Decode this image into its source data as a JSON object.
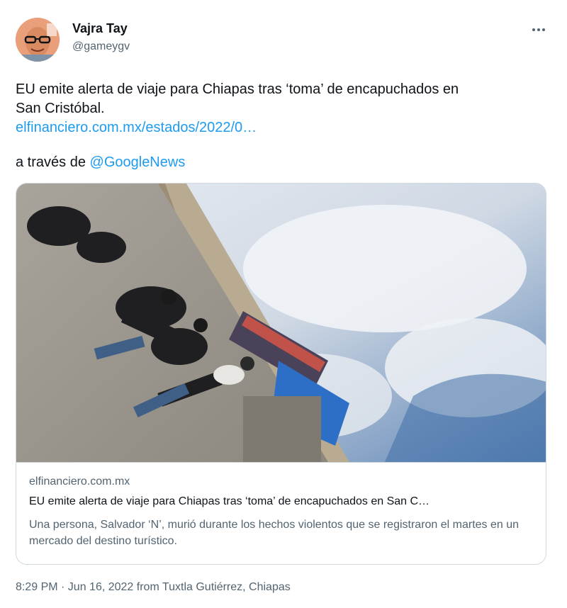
{
  "author": {
    "display_name": "Vajra Tay",
    "handle": "@gameygv",
    "avatar_icon": "user-avatar"
  },
  "menu": {
    "more_icon": "more-horizontal-icon"
  },
  "tweet": {
    "text_line1": "EU emite alerta de viaje para Chiapas tras ‘toma’ de encapuchados en",
    "text_line2": "San Cristóbal.",
    "link": "elfinanciero.com.mx/estados/2022/0…",
    "via_prefix": "a través de ",
    "via_mention": "@GoogleNews"
  },
  "card": {
    "domain": "elfinanciero.com.mx",
    "title": "EU emite alerta de viaje para Chiapas tras ‘toma’ de encapuchados en San C…",
    "description": "Una persona, Salvador ‘N’, murió durante los hechos violentos que se registraron el martes en un mercado del destino turístico."
  },
  "footer": {
    "timestamp": "8:29 PM · Jun 16, 2022 from Tuxtla Gutiérrez, Chiapas"
  },
  "colors": {
    "link": "#1d9bf0",
    "text": "#0f1419",
    "secondary": "#536471",
    "border": "#cfd9de"
  }
}
